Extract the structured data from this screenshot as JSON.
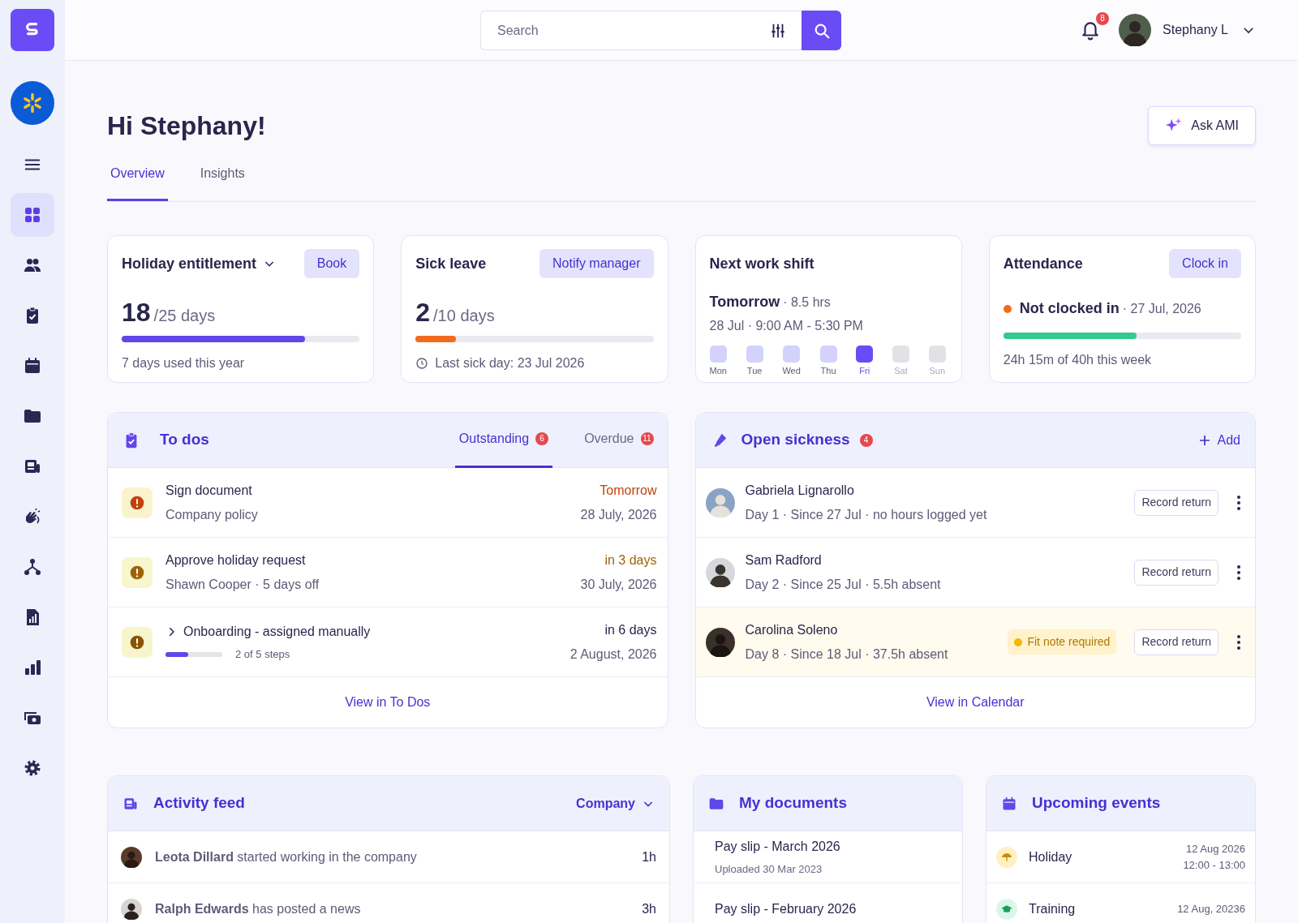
{
  "sidebar": {
    "items": [
      {
        "selected": true
      },
      {
        "selected": false
      },
      {
        "selected": false
      },
      {
        "selected": false
      },
      {
        "selected": false
      },
      {
        "selected": false
      },
      {
        "selected": false
      },
      {
        "selected": false
      },
      {
        "selected": false
      },
      {
        "selected": false
      },
      {
        "selected": false
      },
      {
        "selected": false
      }
    ]
  },
  "topbar": {
    "search": {
      "placeholder": "Search"
    },
    "notifications": "8",
    "user": "Stephany L"
  },
  "header": {
    "greeting": "Hi Stephany!",
    "ask_button": "Ask AMI",
    "tabs": [
      {
        "label": "Overview",
        "selected": true
      },
      {
        "label": "Insights",
        "selected": false
      }
    ]
  },
  "summary": [
    {
      "kind": "holiday",
      "title": "Holiday entitlement",
      "dropdown": true,
      "action": "Book",
      "value": "18",
      "unit": "/25 days",
      "level": 0.77,
      "note": "7 days used this year"
    },
    {
      "kind": "sick",
      "title": "Sick leave",
      "action": "Notify manager",
      "value": "2",
      "unit": "/10 days",
      "level": 0.17,
      "note": "Last sick day:  23 Jul 2026"
    },
    {
      "kind": "shift",
      "title": "Next work shift",
      "day": "Tomorrow",
      "hours": "· 8.5 hrs",
      "time": "28 Jul · 9:00 AM - 5:30 PM",
      "days": [
        {
          "label": "Mon",
          "working": true,
          "selected": false
        },
        {
          "label": "Tue",
          "working": true,
          "selected": false
        },
        {
          "label": "Wed",
          "working": true,
          "selected": false
        },
        {
          "label": "Thu",
          "working": true,
          "selected": false
        },
        {
          "label": "Fri",
          "working": true,
          "selected": true
        },
        {
          "label": "Sat",
          "working": false,
          "selected": false
        },
        {
          "label": "Sun",
          "working": false,
          "selected": false
        }
      ]
    },
    {
      "kind": "attendance",
      "title": "Attendance",
      "action": "Clock in",
      "status": "Not clocked in",
      "date": "· 27 Jul, 2026",
      "level": 0.56,
      "note": "24h 15m of 40h this week"
    }
  ],
  "todos": {
    "title": "To dos",
    "tabs": [
      {
        "label": "Outstanding",
        "count": "6",
        "selected": true
      },
      {
        "label": "Overdue",
        "count": "11",
        "selected": false
      }
    ],
    "items": [
      {
        "kind": "task",
        "title": "Sign document",
        "subtitle": "Company policy",
        "due": "Tomorrow",
        "date": "28 July, 2026",
        "color": "#c2410c"
      },
      {
        "kind": "task",
        "title": "Approve holiday request",
        "subtitle": "Shawn Cooper · 5 days off",
        "due": "in 3 days",
        "date": "30 July, 2026",
        "color": "#a16207"
      },
      {
        "kind": "checklist",
        "title": "Onboarding - assigned manually",
        "expanded": false,
        "level": 0.4,
        "steps": "2 of 5 steps",
        "due": "in 6 days",
        "date": "2 August, 2026",
        "color": "#29264d"
      }
    ],
    "link": "View in To Dos"
  },
  "sickness": {
    "title": "Open sickness",
    "count": "4",
    "add": "Add",
    "people": [
      {
        "name": "Gabriela Lignarollo",
        "detail": "Day 1 · Since 27 Jul · no hours logged yet",
        "action": "Record return",
        "highlighted": false
      },
      {
        "name": "Sam Radford",
        "detail": "Day 2 · Since 25 Jul · 5.5h absent",
        "action": "Record return",
        "highlighted": false
      },
      {
        "name": "Carolina Soleno",
        "detail": "Day 8 · Since 18 Jul · 37.5h absent",
        "badge": "Fit note required",
        "action": "Record return",
        "highlighted": true
      }
    ],
    "link": "View in Calendar"
  },
  "activity": {
    "title": "Activity feed",
    "filter": "Company",
    "items": [
      {
        "text": "**Leota Dillard** started working in the company",
        "time": "1h"
      },
      {
        "text": "**Ralph Edwards** has posted a news",
        "time": "3h"
      }
    ]
  },
  "documents": {
    "title": "My documents",
    "items": [
      {
        "title": "Pay slip - March 2026",
        "subtitle": "Uploaded 30 Mar 2023"
      },
      {
        "title": "Pay slip - February 2026"
      }
    ]
  },
  "events": {
    "title": "Upcoming events",
    "items": [
      {
        "kind": "holiday",
        "label": "Holiday",
        "date": "12 Aug 2026",
        "time": "12:00 - 13:00"
      },
      {
        "kind": "training",
        "label": "Training",
        "date": "12 Aug, 20236"
      }
    ]
  }
}
